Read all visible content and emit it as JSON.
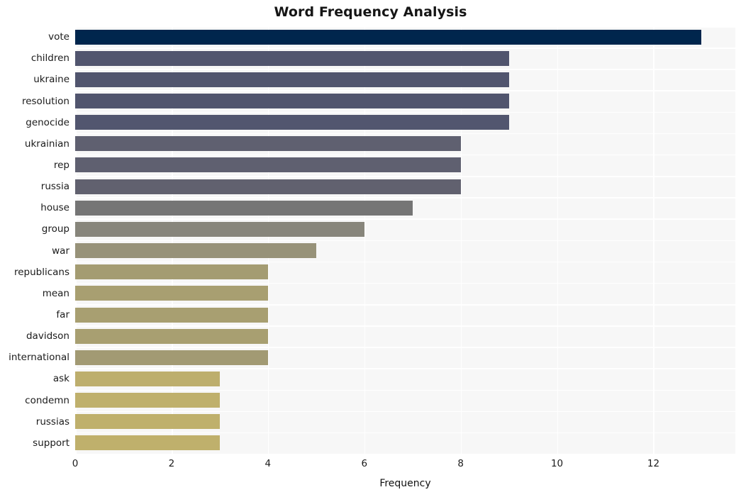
{
  "chart_data": {
    "type": "bar",
    "orientation": "horizontal",
    "title": "Word Frequency Analysis",
    "xlabel": "Frequency",
    "ylabel": "",
    "xlim": [
      0,
      13.7
    ],
    "ylim": [
      0,
      20
    ],
    "grid": true,
    "legend": null,
    "xticks": [
      0,
      2,
      4,
      6,
      8,
      10,
      12
    ],
    "xtick_labels": [
      "0",
      "2",
      "4",
      "6",
      "8",
      "10",
      "12"
    ],
    "categories": [
      "vote",
      "children",
      "ukraine",
      "resolution",
      "genocide",
      "ukrainian",
      "rep",
      "russia",
      "house",
      "group",
      "war",
      "republicans",
      "mean",
      "far",
      "davidson",
      "international",
      "ask",
      "condemn",
      "russias",
      "support"
    ],
    "values": [
      13,
      9,
      9,
      9,
      9,
      8,
      8,
      8,
      7,
      6,
      5,
      4,
      4,
      4,
      4,
      4,
      3,
      3,
      3,
      3
    ],
    "bar_colors": [
      "#00264d",
      "#51556e",
      "#51556e",
      "#51556e",
      "#52566f",
      "#5f6070",
      "#5f6070",
      "#61616f",
      "#757575",
      "#87857b",
      "#979279",
      "#a49c72",
      "#a89f71",
      "#a89f71",
      "#a89f71",
      "#a29a73",
      "#bdae6d",
      "#bfb06c",
      "#bfb06c",
      "#bfb06c"
    ]
  },
  "style": {
    "figure_background": "#ffffff",
    "plot_background": "#f7f7f7",
    "grid_color": "#ffffff",
    "text_color": "#1b1b1b",
    "title_color": "#151515"
  }
}
